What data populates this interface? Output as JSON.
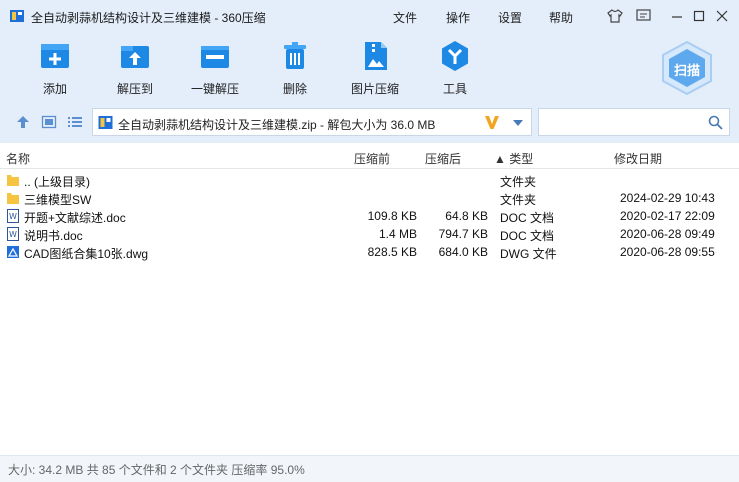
{
  "window": {
    "title": "全自动剥蒜机结构设计及三维建模 - 360压缩",
    "menu": [
      "文件",
      "操作",
      "设置",
      "帮助"
    ]
  },
  "toolbar": {
    "add": "添加",
    "extract_to": "解压到",
    "one_click_extract": "一键解压",
    "delete": "删除",
    "image_compress": "图片压缩",
    "tools": "工具",
    "scan": "扫描"
  },
  "address": {
    "path": "全自动剥蒜机结构设计及三维建模.zip - 解包大小为 36.0 MB"
  },
  "search": {
    "placeholder": ""
  },
  "columns": {
    "name": "名称",
    "compressed": "压缩前",
    "original": "压缩后",
    "type": "▲ 类型",
    "modified": "修改日期"
  },
  "files": [
    {
      "icon": "folder-icon",
      "name": ".. (上级目录)",
      "compressed": "",
      "original": "",
      "type": "文件夹",
      "date": ""
    },
    {
      "icon": "folder-icon",
      "name": "三维模型SW",
      "compressed": "",
      "original": "",
      "type": "文件夹",
      "date": "2024-02-29 10:43"
    },
    {
      "icon": "doc-icon",
      "name": "开题+文献综述.doc",
      "compressed": "109.8 KB",
      "original": "64.8 KB",
      "type": "DOC 文档",
      "date": "2020-02-17 22:09"
    },
    {
      "icon": "doc-icon",
      "name": "说明书.doc",
      "compressed": "1.4 MB",
      "original": "794.7 KB",
      "type": "DOC 文档",
      "date": "2020-06-28 09:49"
    },
    {
      "icon": "dwg-icon",
      "name": "CAD图纸合集10张.dwg",
      "compressed": "828.5 KB",
      "original": "684.0 KB",
      "type": "DWG 文件",
      "date": "2020-06-28 09:55"
    }
  ],
  "status": {
    "text": "大小: 34.2 MB 共 85 个文件和 2 个文件夹 压缩率 95.0%"
  },
  "colors": {
    "accent": "#1e88e5",
    "top_background": "#e4eefb",
    "folder": "#f5c542"
  }
}
